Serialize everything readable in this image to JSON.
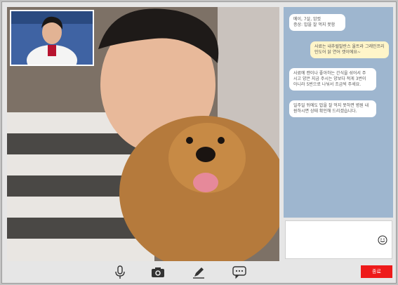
{
  "chat": {
    "messages": [
      {
        "side": "in",
        "text": "메이, 7살, 암컷\n증상: 밥을 잘 먹지 못함"
      },
      {
        "side": "out",
        "text": "사료는 내추럴발란스 울트라 그레인프리\n인도어 닭 연어 캣이에요~"
      },
      {
        "side": "in",
        "text": "사료에 캔이나 좋아하는 간식을 섞어서 주\n시고 양은 지금 주시는 양보다 적게 3번이\n아니라 5번으로 나눠서 조금씩 주세요."
      },
      {
        "side": "in",
        "text": "일주일 뒤에도 밥을 잘 먹지 못하면 병원 내\n원하시면 상태 확인해 드리겠습니다."
      }
    ]
  },
  "controls": {
    "end_label": "종료"
  },
  "icons": {
    "mic": "microphone-icon",
    "camera": "camera-icon",
    "pen": "pen-icon",
    "chat": "chat-bubble-icon",
    "emoji": "smiley-icon"
  },
  "colors": {
    "chat_bg": "#9eb6cf",
    "bubble_in": "#ffffff",
    "bubble_out": "#fff5c9",
    "end_button": "#ee1a1a"
  }
}
